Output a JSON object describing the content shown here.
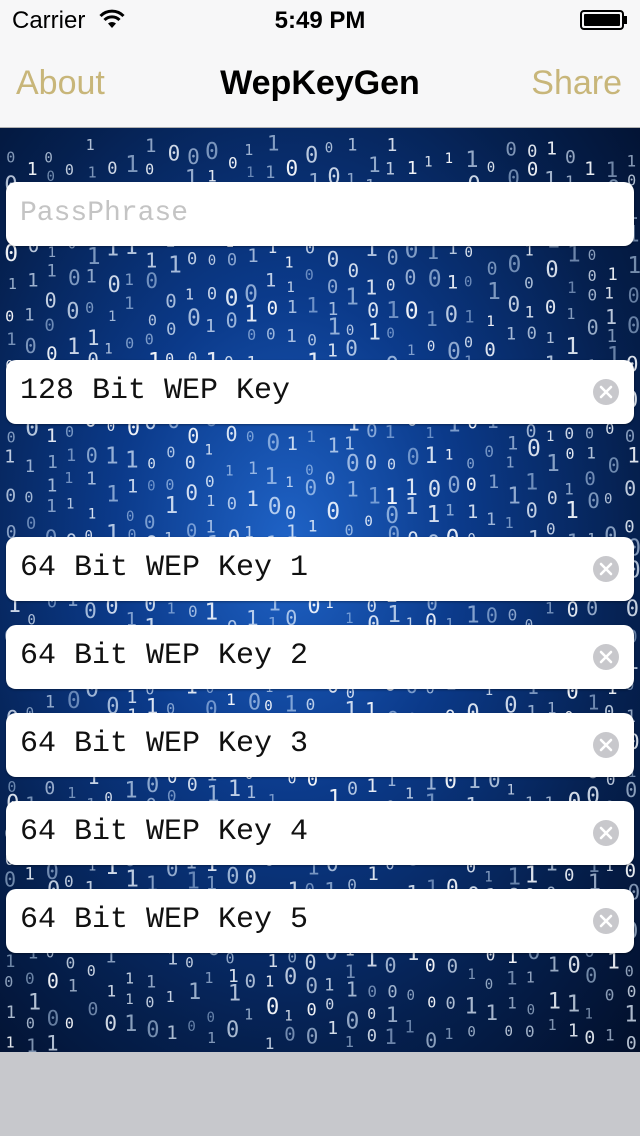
{
  "status_bar": {
    "carrier": "Carrier",
    "time": "5:49 PM"
  },
  "nav": {
    "left_label": "About",
    "title": "WepKeyGen",
    "right_label": "Share"
  },
  "passphrase": {
    "placeholder": "PassPhrase",
    "value": ""
  },
  "fields": [
    {
      "label": "128 Bit WEP Key"
    },
    {
      "label": "64 Bit WEP Key 1"
    },
    {
      "label": "64 Bit WEP Key 2"
    },
    {
      "label": "64 Bit WEP Key 3"
    },
    {
      "label": "64 Bit WEP Key 4"
    },
    {
      "label": "64 Bit WEP Key 5"
    }
  ],
  "icons": {
    "wifi": "wifi-icon",
    "battery": "battery-icon",
    "clear": "clear-icon"
  },
  "colors": {
    "nav_button": "#c8b67a",
    "background_blue": "#1f63c7"
  }
}
